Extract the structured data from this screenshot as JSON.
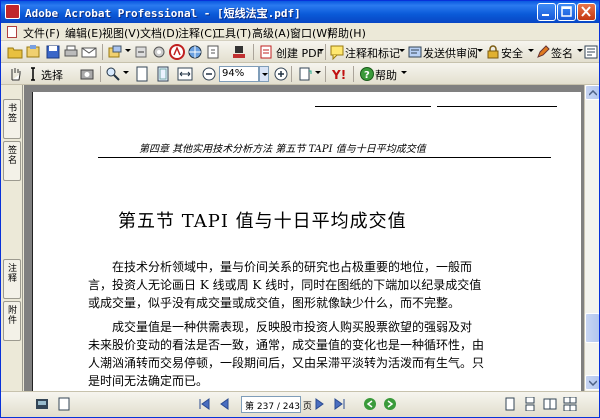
{
  "window": {
    "title": "Adobe Acrobat Professional - [短线法宝.pdf]"
  },
  "menu": {
    "items": [
      "文件(F)",
      "编辑(E)",
      "视图(V)",
      "文档(D)",
      "注释(C)",
      "工具(T)",
      "高级(A)",
      "窗口(W)",
      "帮助(H)"
    ]
  },
  "toolbar1": {
    "create_pdf": "创建 PDF",
    "comment_markup": "注释和标记",
    "send_review": "发送供审阅",
    "security": "安全",
    "sign": "签名"
  },
  "toolbar2": {
    "select_label": "选择",
    "zoom_value": "94%",
    "help_label": "帮助"
  },
  "side_tabs": {
    "tab1": "书签",
    "tab2": "签名",
    "tab3": "注释",
    "tab4": "附件"
  },
  "document": {
    "running_header": "第四章   其他实用技术分析方法   第五节   TAPI 值与十日平均成交值",
    "section_title": "第五节   TAPI 值与十日平均成交值",
    "paragraph1": [
      "在技术分析领域中，量与价间关系的研究也占极重要的地位，一般而",
      "言，投资人无论画日 K 线或周 K 线时，同时在图纸的下端加以纪录成交值",
      "或成交量，似乎没有成交量或成交值，图形就像缺少什么，而不完整。"
    ],
    "paragraph2": [
      "成交量值是一种供需表现，反映股市投资人购买股票欲望的强弱及对",
      "未来股价变动的看法是否一致，通常，成交量值的变化也是一种循环性，由",
      "人潮汹涌转而交易停顿，一段期间后，又由呆滞平淡转为活泼而有生气。只",
      "是时间无法确定而已。"
    ]
  },
  "statusbar": {
    "page_indicator": "第 237 / 243 页"
  },
  "colors": {
    "titlebar": "#0a58e0",
    "chrome": "#ece9d8",
    "doc_background": "#808080"
  }
}
